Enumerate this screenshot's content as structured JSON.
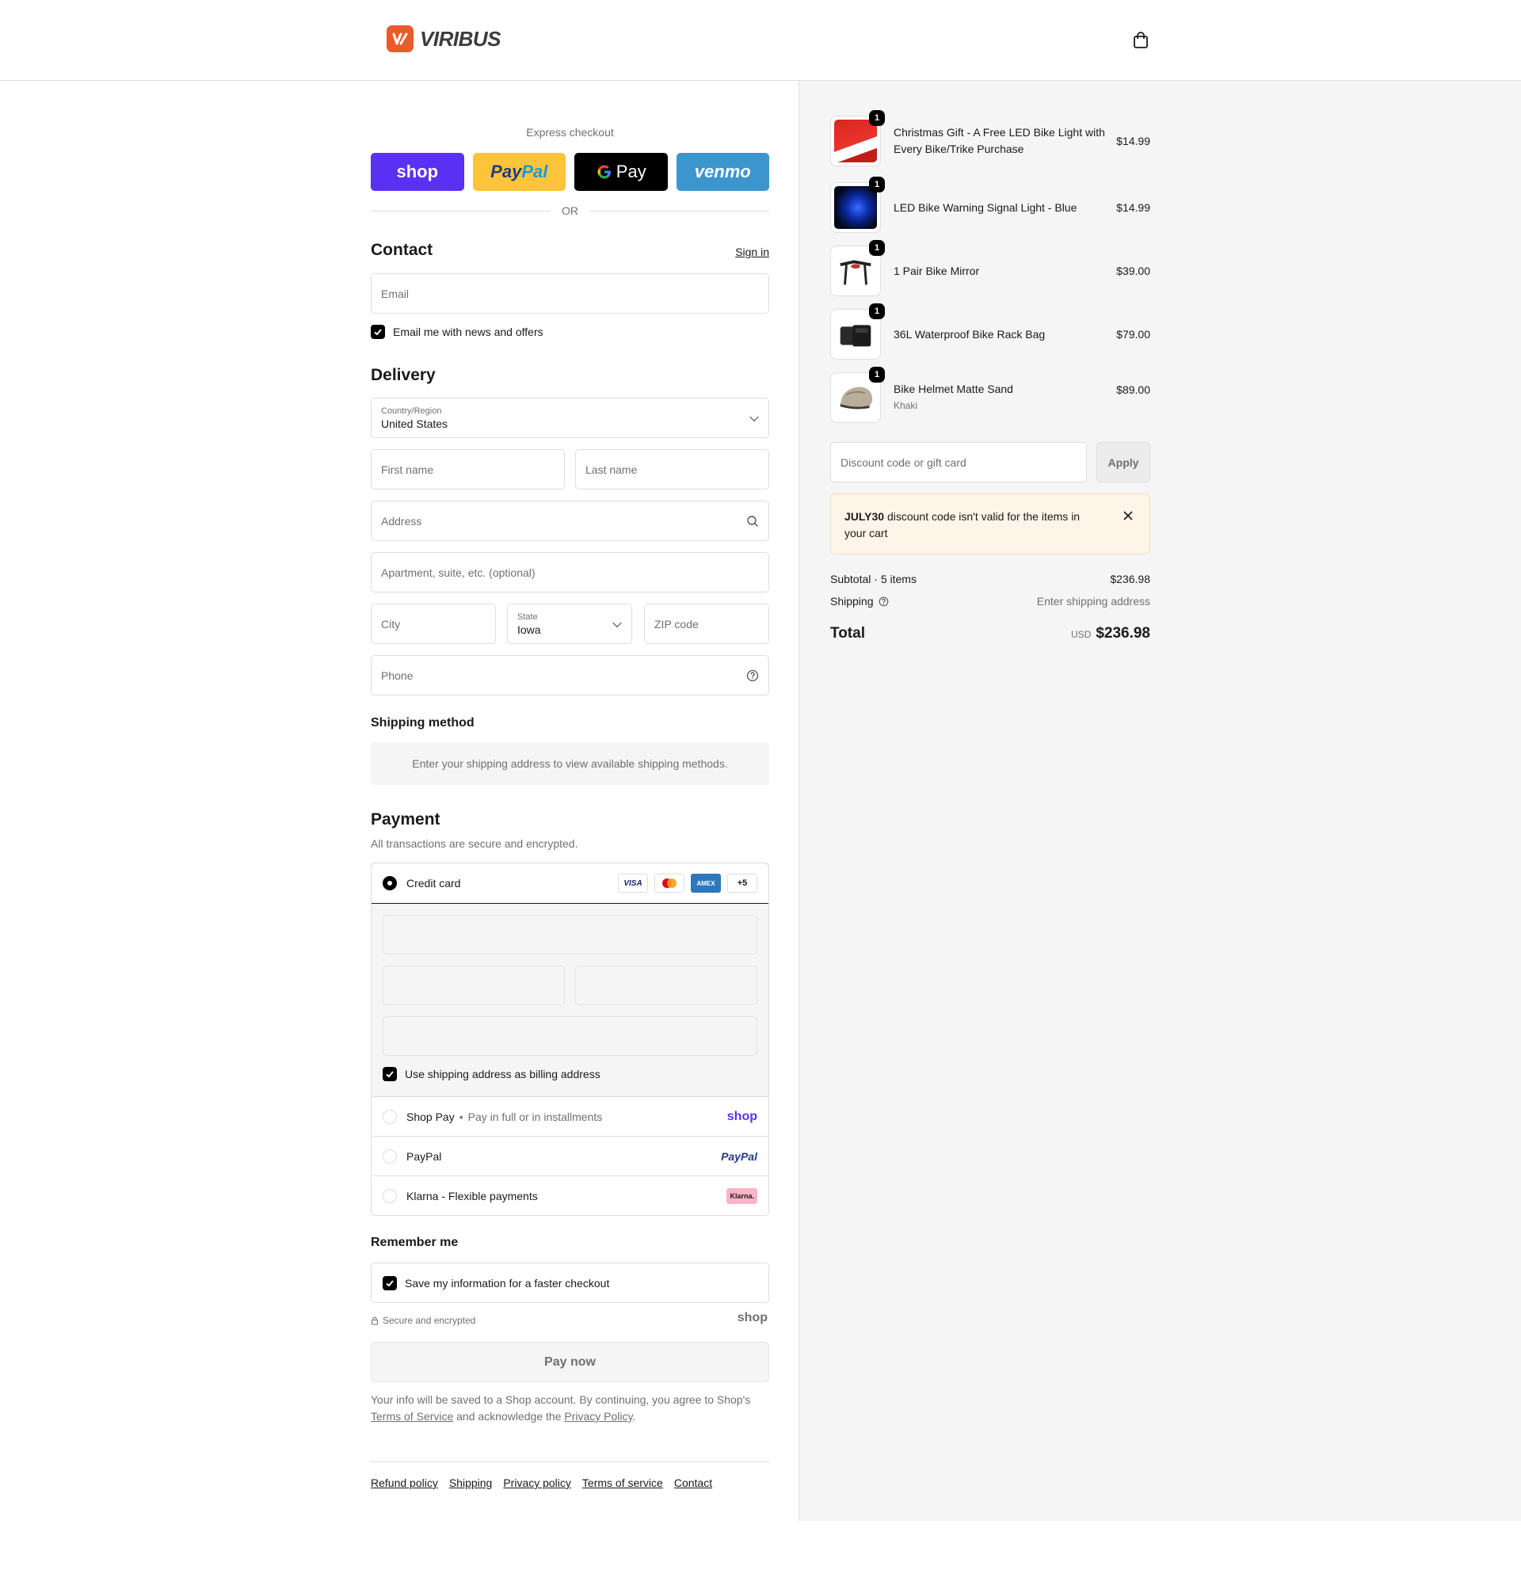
{
  "brand": {
    "name": "VIRIBUS",
    "accent": "#ea5a2a"
  },
  "express": {
    "title": "Express checkout",
    "shop_label": "shop",
    "paypal_a": "Pay",
    "paypal_b": "Pal",
    "gpay_label": "Pay",
    "venmo_label": "venmo",
    "or": "OR"
  },
  "contact": {
    "title": "Contact",
    "sign_in": "Sign in",
    "email_placeholder": "Email",
    "news_label": "Email me with news and offers"
  },
  "delivery": {
    "title": "Delivery",
    "country_label": "Country/Region",
    "country_value": "United States",
    "first_name": "First name",
    "last_name": "Last name",
    "address": "Address",
    "apartment": "Apartment, suite, etc. (optional)",
    "city": "City",
    "state_label": "State",
    "state_value": "Iowa",
    "zip": "ZIP code",
    "phone": "Phone"
  },
  "shipping_method": {
    "title": "Shipping method",
    "message": "Enter your shipping address to view available shipping methods."
  },
  "payment": {
    "title": "Payment",
    "subtitle": "All transactions are secure and encrypted.",
    "credit_card": "Credit card",
    "card_logos": [
      "VISA",
      "",
      "AMEX",
      "+5"
    ],
    "billing_same": "Use shipping address as billing address",
    "shop_pay": "Shop Pay",
    "shop_pay_desc": "Pay in full or in installments",
    "shop_logo": "shop",
    "paypal": "PayPal",
    "paypal_logo": "PayPal",
    "klarna": "Klarna - Flexible payments",
    "klarna_logo": "Klarna."
  },
  "remember": {
    "title": "Remember me",
    "save_label": "Save my information for a faster checkout",
    "secure": "Secure and encrypted",
    "shop_logo": "shop"
  },
  "pay_now": "Pay now",
  "legal": {
    "text1": "Your info will be saved to a Shop account. By continuing, you agree to Shop's",
    "tos": "Terms of Service",
    "text2": "and acknowledge the",
    "privacy": "Privacy Policy",
    "text3": "."
  },
  "footer": [
    "Refund policy",
    "Shipping",
    "Privacy policy",
    "Terms of service",
    "Contact"
  ],
  "cart": {
    "items": [
      {
        "name": "Christmas Gift - A Free LED Bike Light with Every Bike/Trike Purchase",
        "variant": "",
        "price": "$14.99",
        "qty": "1"
      },
      {
        "name": "LED Bike Warning Signal Light - Blue",
        "variant": "",
        "price": "$14.99",
        "qty": "1"
      },
      {
        "name": "1 Pair Bike Mirror",
        "variant": "",
        "price": "$39.00",
        "qty": "1"
      },
      {
        "name": "36L Waterproof Bike Rack Bag",
        "variant": "",
        "price": "$79.00",
        "qty": "1"
      },
      {
        "name": "Bike Helmet Matte Sand",
        "variant": "Khaki",
        "price": "$89.00",
        "qty": "1"
      }
    ],
    "discount_placeholder": "Discount code or gift card",
    "apply": "Apply",
    "notice_code": "JULY30",
    "notice_text": " discount code isn't valid for the items in your cart",
    "subtotal_label": "Subtotal · 5 items",
    "subtotal": "$236.98",
    "shipping_label": "Shipping",
    "shipping_value": "Enter shipping address",
    "total_label": "Total",
    "currency": "USD",
    "total": "$236.98"
  }
}
